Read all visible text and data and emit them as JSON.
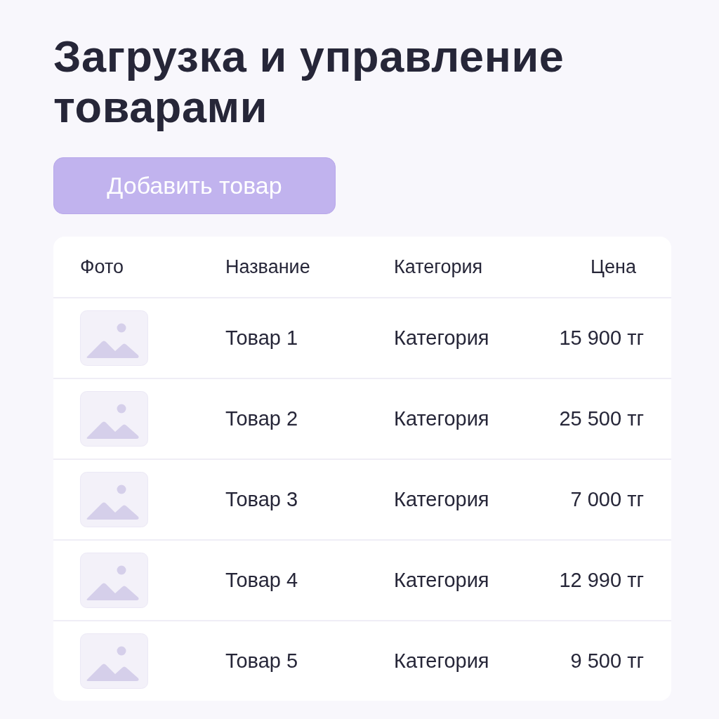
{
  "title": "Загрузка и управление товарами",
  "add_button": {
    "label": "Добавить товар"
  },
  "table": {
    "columns": [
      "Фото",
      "Название",
      "Категория",
      "Цена"
    ],
    "rows": [
      {
        "name": "Товар 1",
        "category": "Категория",
        "price": "15 900 тг"
      },
      {
        "name": "Товар 2",
        "category": "Категория",
        "price": "25 500 тг"
      },
      {
        "name": "Товар 3",
        "category": "Категория",
        "price": "7 000 тг"
      },
      {
        "name": "Товар 4",
        "category": "Категория",
        "price": "12 990 тг"
      },
      {
        "name": "Товар 5",
        "category": "Категория",
        "price": "9 500 тг"
      }
    ]
  }
}
